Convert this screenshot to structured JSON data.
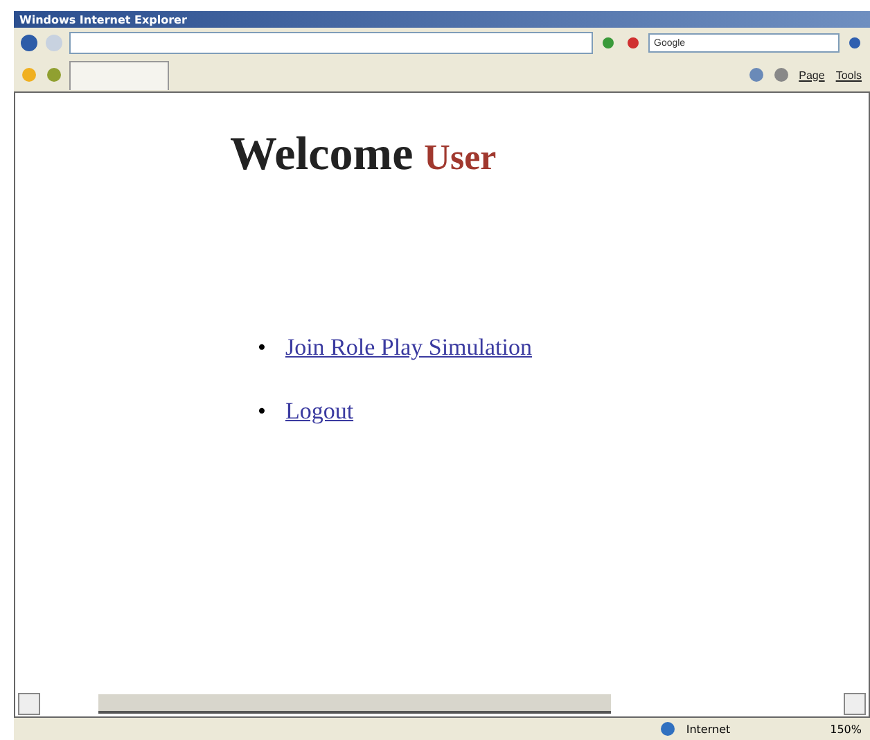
{
  "window": {
    "title": "Windows Internet Explorer"
  },
  "search": {
    "placeholder": "Google"
  },
  "command_bar": [
    {
      "label": "Page",
      "kind": "menu"
    },
    {
      "label": "Tools",
      "kind": "menu"
    }
  ],
  "page": {
    "heading": [
      {
        "text": "Welcome",
        "kind": "plain"
      },
      {
        "text": "User",
        "kind": "accent"
      }
    ],
    "links": [
      {
        "bullet": "•",
        "label": "Join Role Play Simulation"
      },
      {
        "bullet": "•",
        "label": "Logout"
      }
    ]
  },
  "status_bar": {
    "zone": "Internet",
    "zoom": "150%"
  }
}
